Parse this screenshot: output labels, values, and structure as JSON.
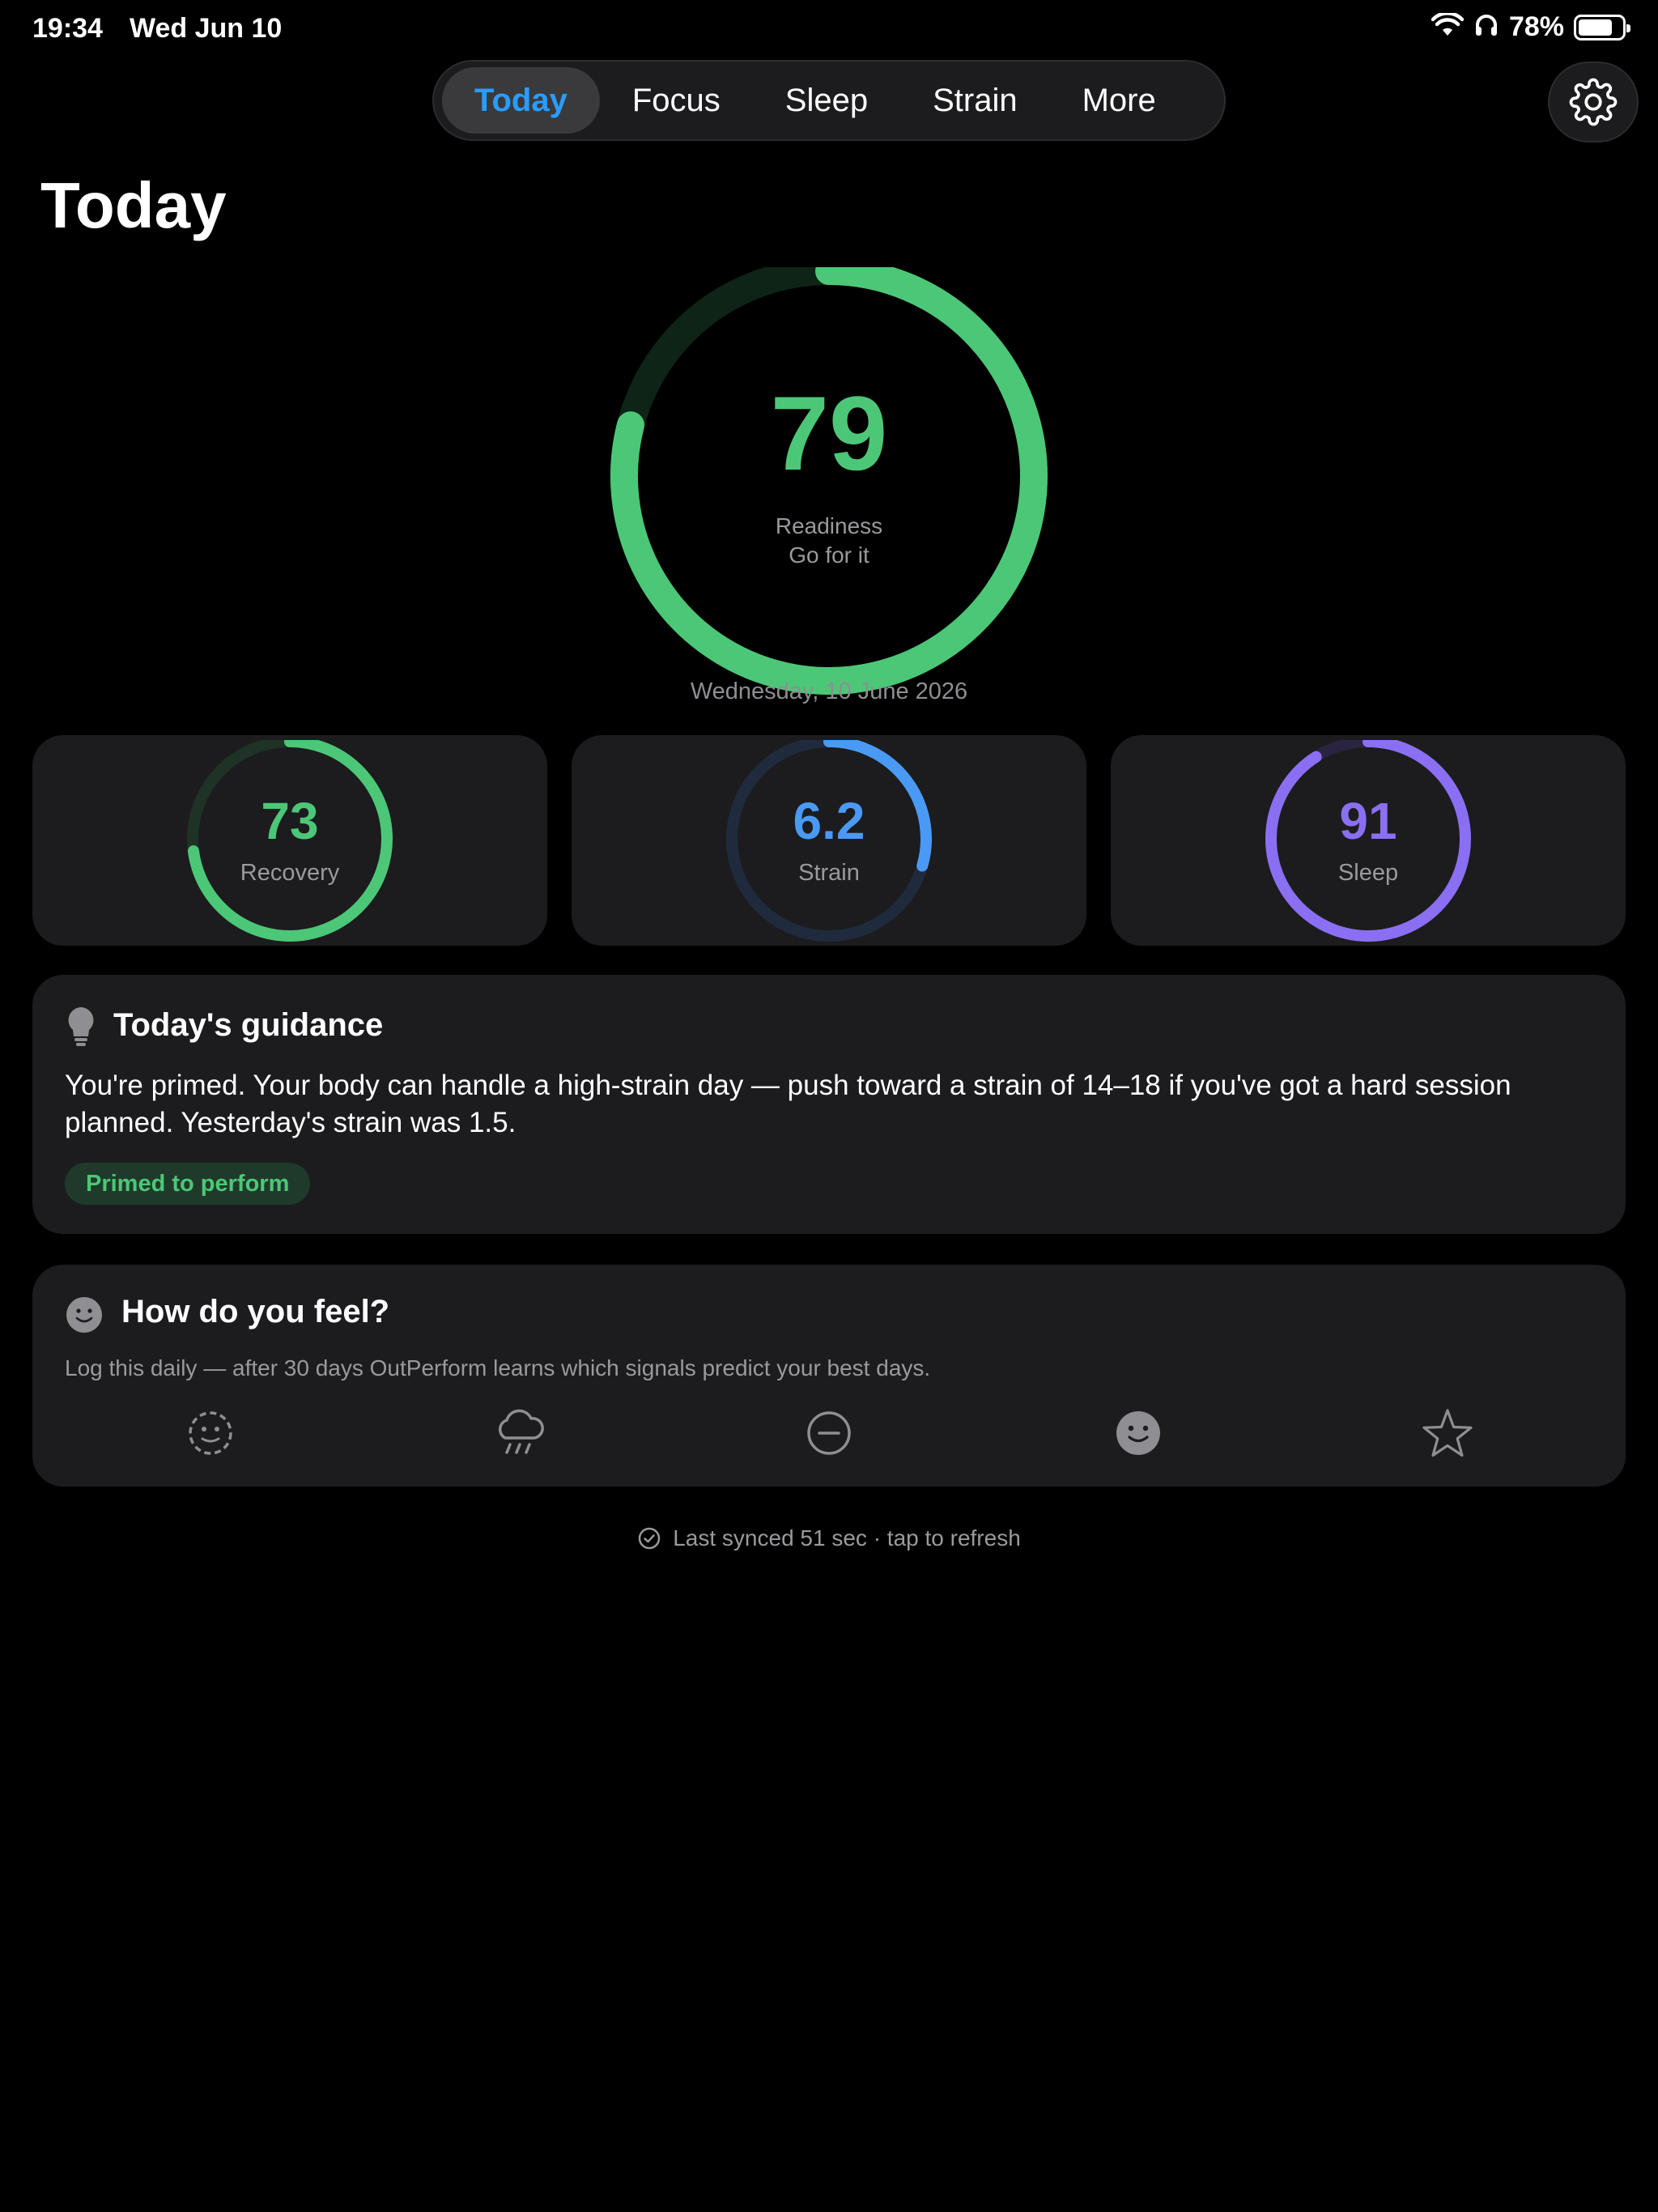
{
  "status": {
    "time": "19:34",
    "date": "Wed Jun 10",
    "battery": "78%"
  },
  "tabs": [
    {
      "label": "Today",
      "active": true
    },
    {
      "label": "Focus"
    },
    {
      "label": "Sleep"
    },
    {
      "label": "Strain"
    },
    {
      "label": "More"
    }
  ],
  "page": {
    "title": "Today"
  },
  "readiness": {
    "score": "79",
    "value": 0.79,
    "label": "Readiness",
    "sub": "Go for it",
    "date": "Wednesday, 10 June 2026",
    "color": "#4cc777"
  },
  "metrics": [
    {
      "value": "73",
      "label": "Recovery",
      "fraction": 0.73,
      "color": "#4cc777"
    },
    {
      "value": "6.2",
      "label": "Strain",
      "fraction": 0.295,
      "color": "#4a9af5"
    },
    {
      "value": "91",
      "label": "Sleep",
      "fraction": 0.91,
      "color": "#8b6ff2"
    }
  ],
  "guidance": {
    "icon": "lightbulb-icon",
    "title": "Today's guidance",
    "body": "You're primed. Your body can handle a high-strain day — push toward a strain of 14–18 if you've got a hard session planned. Yesterday's strain was 1.5.",
    "tag": "Primed to perform"
  },
  "feel": {
    "icon": "smiley-icon",
    "title": "How do you feel?",
    "subtitle": "Log this daily — after 30 days OutPerform learns which signals predict your best days.",
    "moods": [
      "dashed-face-icon",
      "rain-cloud-icon",
      "minus-circle-icon",
      "smiley-face-icon",
      "star-icon"
    ]
  },
  "sync": {
    "text": "Last synced 51 sec · tap to refresh"
  }
}
